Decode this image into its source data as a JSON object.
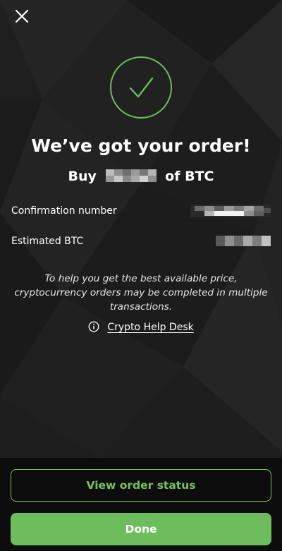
{
  "close_icon": "close-icon",
  "success_icon": "checkmark-icon",
  "headline": "We’ve got your order!",
  "buy": {
    "prefix": "Buy",
    "suffix": "of BTC"
  },
  "details": {
    "confirmation_label": "Confirmation number",
    "estimated_label": "Estimated BTC"
  },
  "note": "To help you get the best available price, cryptocurrency orders may be completed in multiple transactions.",
  "help_link": {
    "icon": "info-icon",
    "label": "Crypto Help Desk"
  },
  "buttons": {
    "view_status": "View order status",
    "done": "Done"
  },
  "colors": {
    "accent": "#6ebd5d",
    "background": "#1e1e1e",
    "bottom_bar": "#0d0d0d"
  }
}
